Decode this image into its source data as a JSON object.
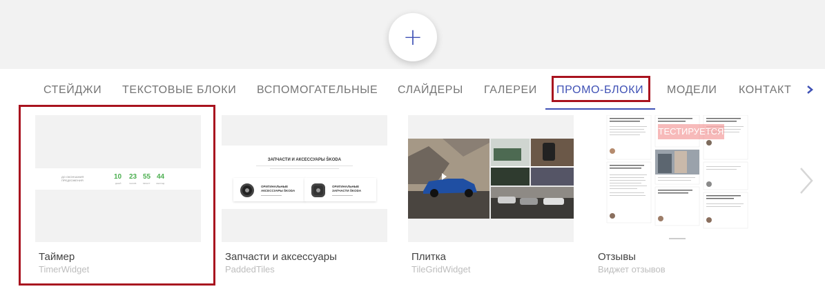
{
  "add_button": {
    "label": "+"
  },
  "tabs": [
    {
      "label": "СТЕЙДЖИ"
    },
    {
      "label": "ТЕКСТОВЫЕ БЛОКИ"
    },
    {
      "label": "ВСПОМОГАТЕЛЬНЫЕ"
    },
    {
      "label": "СЛАЙДЕРЫ"
    },
    {
      "label": "ГАЛЕРЕИ"
    },
    {
      "label": "ПРОМО-БЛОКИ",
      "active": true
    },
    {
      "label": "МОДЕЛИ"
    },
    {
      "label": "КОНТАКТ"
    }
  ],
  "cards": [
    {
      "title": "Таймер",
      "subtitle": "TimerWidget",
      "thumb": {
        "caption": "ДО ОКОНЧАНИЯ ПРЕДЛОЖЕНИЯ",
        "numbers": [
          "10",
          "23",
          "55",
          "44"
        ],
        "labels": [
          "ДНЕЙ",
          "ЧАСОВ",
          "МИНУТ",
          "СЕКУНД"
        ]
      }
    },
    {
      "title": "Запчасти и аксессуары",
      "subtitle": "PaddedTiles",
      "thumb": {
        "heading": "ЗАПЧАСТИ И АКСЕССУАРЫ ŠKODA",
        "tiles": [
          "ОРИГИНАЛЬНЫЕ АКСЕССУАРЫ ŠKODA",
          "ОРИГИНАЛЬНЫЕ ЗАПЧАСТИ ŠKODA"
        ]
      }
    },
    {
      "title": "Плитка",
      "subtitle": "TileGridWidget"
    },
    {
      "title": "Отзывы",
      "subtitle": "Виджет отзывов",
      "thumb": {
        "badge": "ТЕСТИРУЕТСЯ"
      }
    }
  ],
  "colors": {
    "accent": "#3f51b5",
    "highlight": "#a8121e",
    "timer_green": "#4caf50",
    "tab_text": "#757575"
  },
  "icons": {
    "add": "plus-icon",
    "tabs_scroll": "chevron-right-icon",
    "gallery_next": "chevron-right-icon"
  }
}
